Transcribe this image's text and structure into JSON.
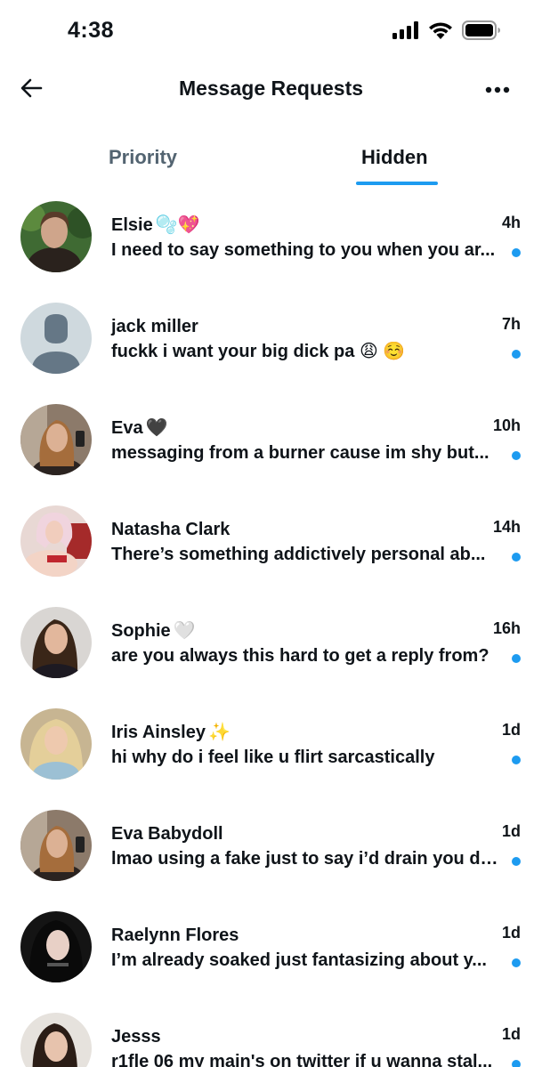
{
  "status_bar": {
    "time": "4:38",
    "icons": [
      "cellular-signal-icon",
      "wifi-icon",
      "battery-icon"
    ]
  },
  "header": {
    "title": "Message Requests",
    "back_icon": "back-arrow-icon",
    "more_icon": "more-icon"
  },
  "tabs": [
    {
      "label": "Priority",
      "active": false
    },
    {
      "label": "Hidden",
      "active": true
    }
  ],
  "colors": {
    "accent": "#1d9bf0",
    "text_primary": "#0f1419",
    "text_secondary": "#536471"
  },
  "messages": [
    {
      "name": "Elsie",
      "name_emoji": "🫧💖",
      "time": "4h",
      "preview": "I need to say something to you when you ar...",
      "unread": true,
      "avatar": "photo"
    },
    {
      "name": "jack miller",
      "name_emoji": "",
      "time": "7h",
      "preview": "fuckk i want your big dick pa",
      "preview_emoji": "😩 ☺️",
      "unread": true,
      "avatar": "default-profile"
    },
    {
      "name": "Eva",
      "name_emoji": "🖤",
      "time": "10h",
      "preview": "messaging from a burner cause im shy but...",
      "unread": true,
      "avatar": "photo"
    },
    {
      "name": "Natasha Clark",
      "name_emoji": "",
      "time": "14h",
      "preview": "There’s something addictively personal ab...",
      "unread": true,
      "avatar": "photo"
    },
    {
      "name": "Sophie",
      "name_emoji": "🤍",
      "time": "16h",
      "preview": "are you always this hard to get a reply from?",
      "unread": true,
      "avatar": "photo"
    },
    {
      "name": "Iris Ainsley",
      "name_emoji": "✨",
      "time": "1d",
      "preview": "hi why do i feel like u flirt sarcastically",
      "unread": true,
      "avatar": "photo"
    },
    {
      "name": "Eva Babydoll",
      "name_emoji": "",
      "time": "1d",
      "preview": "lmao using a fake just to say i’d drain you dr...",
      "unread": true,
      "avatar": "photo"
    },
    {
      "name": "Raelynn Flores",
      "name_emoji": "",
      "time": "1d",
      "preview": "I’m already soaked just fantasizing about y...",
      "unread": true,
      "avatar": "photo"
    },
    {
      "name": "Jesss",
      "name_emoji": "",
      "time": "1d",
      "preview": "r1fle 06 my main's on twitter if u wanna stal...",
      "unread": true,
      "avatar": "photo"
    }
  ]
}
